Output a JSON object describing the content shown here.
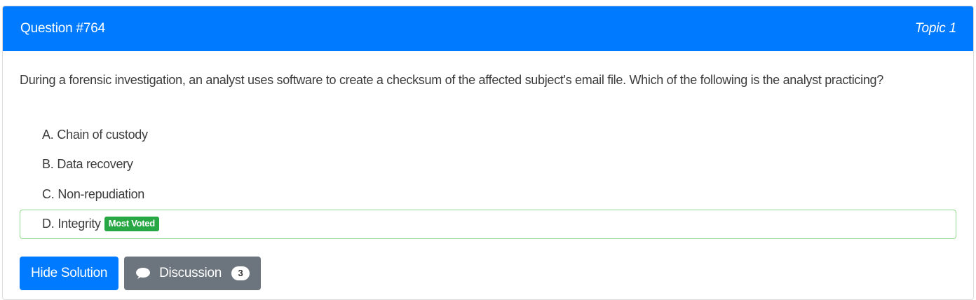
{
  "header": {
    "question_title": "Question #764",
    "topic": "Topic 1"
  },
  "question": {
    "text": "During a forensic investigation, an analyst uses software to create a checksum of the affected subject's email file. Which of the following is the analyst practicing?"
  },
  "choices": [
    {
      "letter": "A.",
      "text": "Chain of custody"
    },
    {
      "letter": "B.",
      "text": "Data recovery"
    },
    {
      "letter": "C.",
      "text": "Non-repudiation"
    },
    {
      "letter": "D.",
      "text": "Integrity",
      "badge": "Most Voted"
    }
  ],
  "actions": {
    "hide_solution_label": "Hide Solution",
    "discussion_label": "Discussion",
    "discussion_count": "3"
  },
  "colors": {
    "primary": "#007bff",
    "secondary": "#6c757d",
    "success": "#28a745",
    "correct_border": "#8fdc8f"
  },
  "icons": {
    "discussion": "chat-bubble-icon"
  }
}
